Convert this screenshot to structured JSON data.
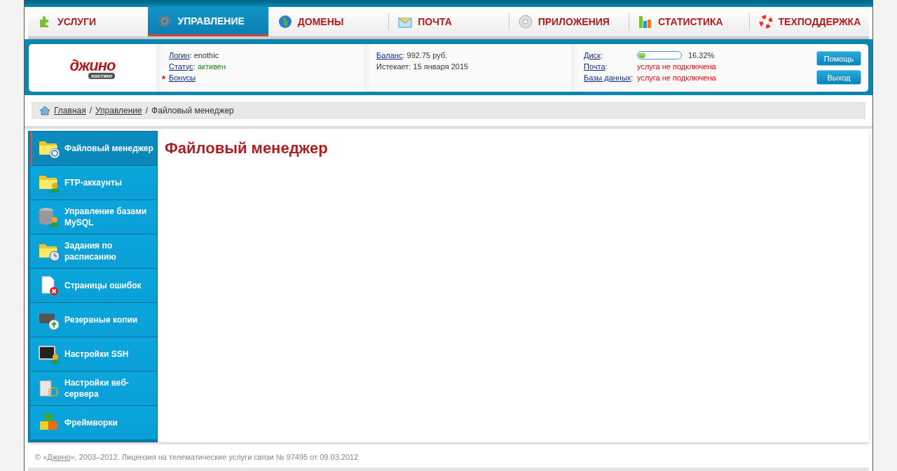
{
  "nav": [
    {
      "label": "УСЛУГИ",
      "selected": false
    },
    {
      "label": "УПРАВЛЕНИЕ",
      "selected": true
    },
    {
      "label": "ДОМЕНЫ",
      "selected": false
    },
    {
      "label": "ПОЧТА",
      "selected": false
    },
    {
      "label": "ПРИЛОЖЕНИЯ",
      "selected": false
    },
    {
      "label": "СТАТИСТИКА",
      "selected": false
    },
    {
      "label": "ТЕХПОДДЕРЖКА",
      "selected": false
    }
  ],
  "logo": {
    "name": "джино",
    "tagline": "хостинг"
  },
  "account": [
    {
      "label": "Логин",
      "value": ": enothic",
      "kind": "plain"
    },
    {
      "label": "Статус",
      "value": ": активен",
      "kind": "ok"
    },
    {
      "label": "Бонусы",
      "starred": true
    }
  ],
  "billing": [
    {
      "label": "Баланс",
      "value": ": 992.75 руб.",
      "kind": "link"
    },
    {
      "label": "Истекает: 15 января 2015",
      "kind": "text"
    }
  ],
  "quota": [
    {
      "label": "Диск",
      "colon": ":",
      "kind": "meter",
      "level": 0.16,
      "reading": "16.32%"
    },
    {
      "label": "Почта",
      "colon": ":",
      "kind": "error",
      "value": "услуга не подключена"
    },
    {
      "label": "Базы данных",
      "colon": ":",
      "kind": "error",
      "value": "услуга не подключена"
    }
  ],
  "buttons": [
    "Помощь",
    "Выход"
  ],
  "breadcrumb": {
    "links": [
      "Главная",
      "Управление"
    ],
    "separator": "/",
    "current": "Файловый менеджер"
  },
  "sidebar": [
    {
      "label": "Файловый менеджер",
      "selected": true
    },
    {
      "label": "FTP-аккаунты",
      "selected": false
    },
    {
      "label": "Управление базами MySQL",
      "selected": false
    },
    {
      "label": "Задания по расписанию",
      "selected": false
    },
    {
      "label": "Страницы ошибок",
      "selected": false
    },
    {
      "label": "Резервные копии",
      "selected": false
    },
    {
      "label": "Настройки SSH",
      "selected": false
    },
    {
      "label": "Настройки веб-сервера",
      "selected": false
    },
    {
      "label": "Фреймворки",
      "selected": false
    }
  ],
  "content": {
    "title": "Файловый менеджер"
  },
  "footer": {
    "before": "© «",
    "link": "Джино",
    "after": "», 2003–2012. Лицензия на телематические услуги связи № 97495 от 09.03.2012"
  }
}
